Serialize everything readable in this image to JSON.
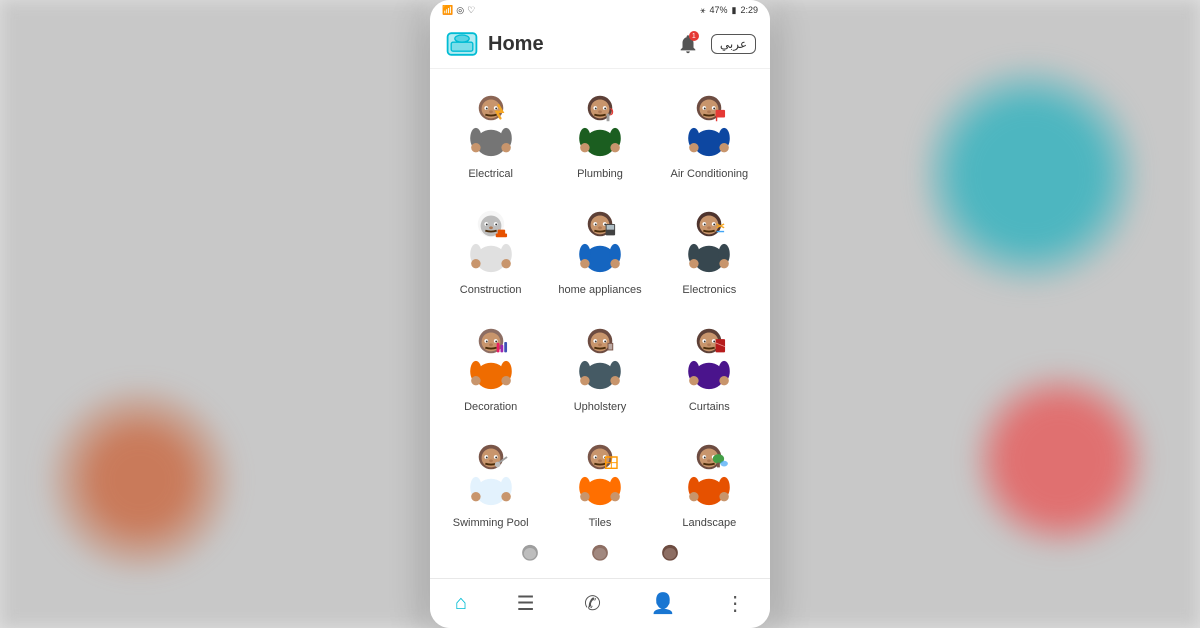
{
  "status_bar": {
    "left": "📶 ⟳ ♡",
    "battery": "47%",
    "time": "2:29",
    "bluetooth": "🔵"
  },
  "header": {
    "title": "Home",
    "lang_btn": "عربي",
    "logo_alt": "app-logo"
  },
  "services": [
    {
      "id": "electrical",
      "label": "Electrical",
      "color": "#f5a623",
      "body_color": "#8B6554"
    },
    {
      "id": "plumbing",
      "label": "Plumbing",
      "color": "#e53935",
      "body_color": "#5D4037"
    },
    {
      "id": "air-conditioning",
      "label": "Air Conditioning",
      "color": "#42a5f5",
      "body_color": "#6D4C41"
    },
    {
      "id": "construction",
      "label": "Construction",
      "color": "#ffffff",
      "body_color": "#9E9E9E"
    },
    {
      "id": "home-appliances",
      "label": "home appliances",
      "color": "#1565c0",
      "body_color": "#5D4037"
    },
    {
      "id": "electronics",
      "label": "Electronics",
      "color": "#f5a623",
      "body_color": "#4E342E"
    },
    {
      "id": "decoration",
      "label": "Decoration",
      "color": "#ff7043",
      "body_color": "#8D6E63"
    },
    {
      "id": "upholstery",
      "label": "Upholstery",
      "color": "#607d8b",
      "body_color": "#6D4C41"
    },
    {
      "id": "curtains",
      "label": "Curtains",
      "color": "#e53935",
      "body_color": "#5D4037"
    },
    {
      "id": "swimming-pool",
      "label": "Swimming Pool",
      "color": "#42a5f5",
      "body_color": "#795548"
    },
    {
      "id": "tiles",
      "label": "Tiles",
      "color": "#ff9800",
      "body_color": "#795548"
    },
    {
      "id": "landscape",
      "label": "Landscape",
      "color": "#66bb6a",
      "body_color": "#6D4C41"
    }
  ],
  "bottom_nav": [
    {
      "id": "home",
      "icon": "⌂",
      "label": "Home",
      "active": true
    },
    {
      "id": "list",
      "icon": "☰",
      "label": "List",
      "active": false
    },
    {
      "id": "phone",
      "icon": "📞",
      "label": "Phone",
      "active": false
    },
    {
      "id": "profile",
      "icon": "👤",
      "label": "Profile",
      "active": false
    },
    {
      "id": "more",
      "icon": "⋮",
      "label": "More",
      "active": false
    }
  ]
}
